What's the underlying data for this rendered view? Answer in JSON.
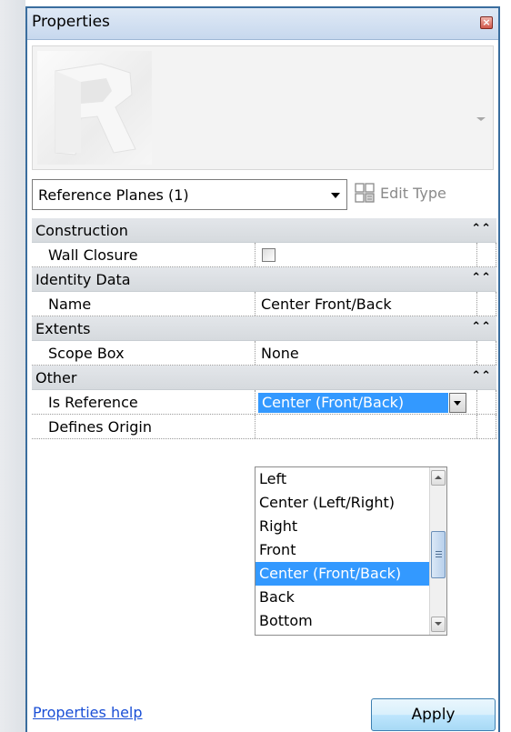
{
  "panel": {
    "title": "Properties",
    "close_glyph": "×"
  },
  "type_selector": {
    "value": "Reference Planes (1)"
  },
  "edit_type": {
    "label": "Edit Type"
  },
  "groups": [
    {
      "label": "Construction",
      "collapse_glyph": "⌃⌃",
      "params": [
        {
          "label": "Wall Closure",
          "kind": "checkbox",
          "checked": false
        }
      ]
    },
    {
      "label": "Identity Data",
      "collapse_glyph": "⌃⌃",
      "params": [
        {
          "label": "Name",
          "kind": "text",
          "value": "Center Front/Back"
        }
      ]
    },
    {
      "label": "Extents",
      "collapse_glyph": "⌃⌃",
      "params": [
        {
          "label": "Scope Box",
          "kind": "text",
          "value": "None"
        }
      ]
    },
    {
      "label": "Other",
      "collapse_glyph": "⌃⌃",
      "params": [
        {
          "label": "Is Reference",
          "kind": "combo",
          "value": "Center (Front/Back)"
        },
        {
          "label": "Defines Origin",
          "kind": "text",
          "value": ""
        }
      ]
    }
  ],
  "dropdown": {
    "options": [
      "Left",
      "Center (Left/Right)",
      "Right",
      "Front",
      "Center (Front/Back)",
      "Back",
      "Bottom"
    ],
    "selected": "Center (Front/Back)"
  },
  "footer": {
    "help_link": "Properties help",
    "apply_label": "Apply"
  },
  "colors": {
    "selection": "#3399ff",
    "link": "#1a4fd6",
    "panel_border": "#3a6d9e"
  },
  "icons": {
    "close": "close-icon",
    "dropdown": "chevron-down-icon",
    "edit_type": "edit-type-icon",
    "collapse": "collapse-up-icon"
  }
}
